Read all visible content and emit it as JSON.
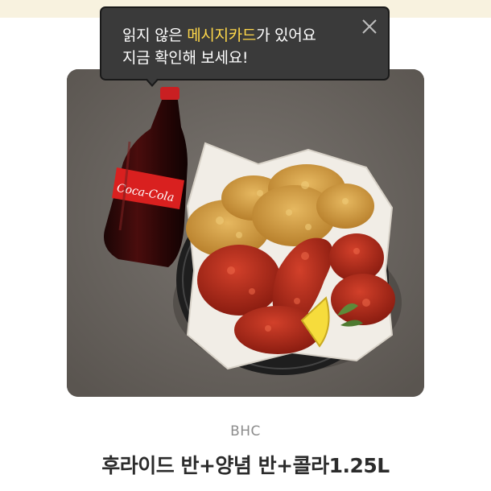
{
  "tooltip": {
    "line1_prefix": "읽지 않은 ",
    "line1_highlight": "메시지카드",
    "line1_suffix": "가 있어요",
    "line2": "지금 확인해 보세요!",
    "highlight_color": "#ffd84a",
    "close_icon": "close-icon"
  },
  "product": {
    "bottle_label": "Coca-Cola",
    "brand": "BHC",
    "title": "후라이드 반+양념 반+콜라1.25L"
  }
}
